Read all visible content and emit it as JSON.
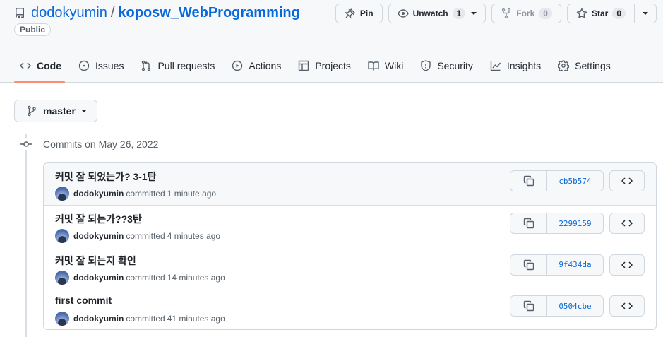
{
  "repo": {
    "owner": "dodokyumin",
    "separator": "/",
    "name": "koposw_WebProgramming",
    "visibility": "Public"
  },
  "actions": {
    "pin_label": "Pin",
    "unwatch_label": "Unwatch",
    "unwatch_count": "1",
    "fork_label": "Fork",
    "fork_count": "0",
    "star_label": "Star",
    "star_count": "0"
  },
  "tabs": [
    {
      "label": "Code",
      "icon": "code-icon",
      "active": true
    },
    {
      "label": "Issues",
      "icon": "issue-icon"
    },
    {
      "label": "Pull requests",
      "icon": "pull-request-icon"
    },
    {
      "label": "Actions",
      "icon": "play-icon"
    },
    {
      "label": "Projects",
      "icon": "table-icon"
    },
    {
      "label": "Wiki",
      "icon": "book-icon"
    },
    {
      "label": "Security",
      "icon": "shield-icon"
    },
    {
      "label": "Insights",
      "icon": "graph-icon"
    },
    {
      "label": "Settings",
      "icon": "gear-icon"
    }
  ],
  "branch": {
    "name": "master"
  },
  "commits_group": {
    "date_label": "Commits on May 26, 2022"
  },
  "commits": [
    {
      "message": "커밋 잘 되었는가? 3-1탄",
      "author": "dodokyumin",
      "verb": "committed",
      "time": "1 minute ago",
      "sha": "cb5b574"
    },
    {
      "message": "커밋 잘 되는가??3탄",
      "author": "dodokyumin",
      "verb": "committed",
      "time": "4 minutes ago",
      "sha": "2299159"
    },
    {
      "message": "커밋 잘 되는지 확인",
      "author": "dodokyumin",
      "verb": "committed",
      "time": "14 minutes ago",
      "sha": "9f434da"
    },
    {
      "message": "first commit",
      "author": "dodokyumin",
      "verb": "committed",
      "time": "41 minutes ago",
      "sha": "0504cbe"
    }
  ],
  "colors": {
    "link": "#0969da",
    "tab_underline": "#fd8c73",
    "border": "#d0d7de",
    "header_bg": "#f6f8fa"
  }
}
